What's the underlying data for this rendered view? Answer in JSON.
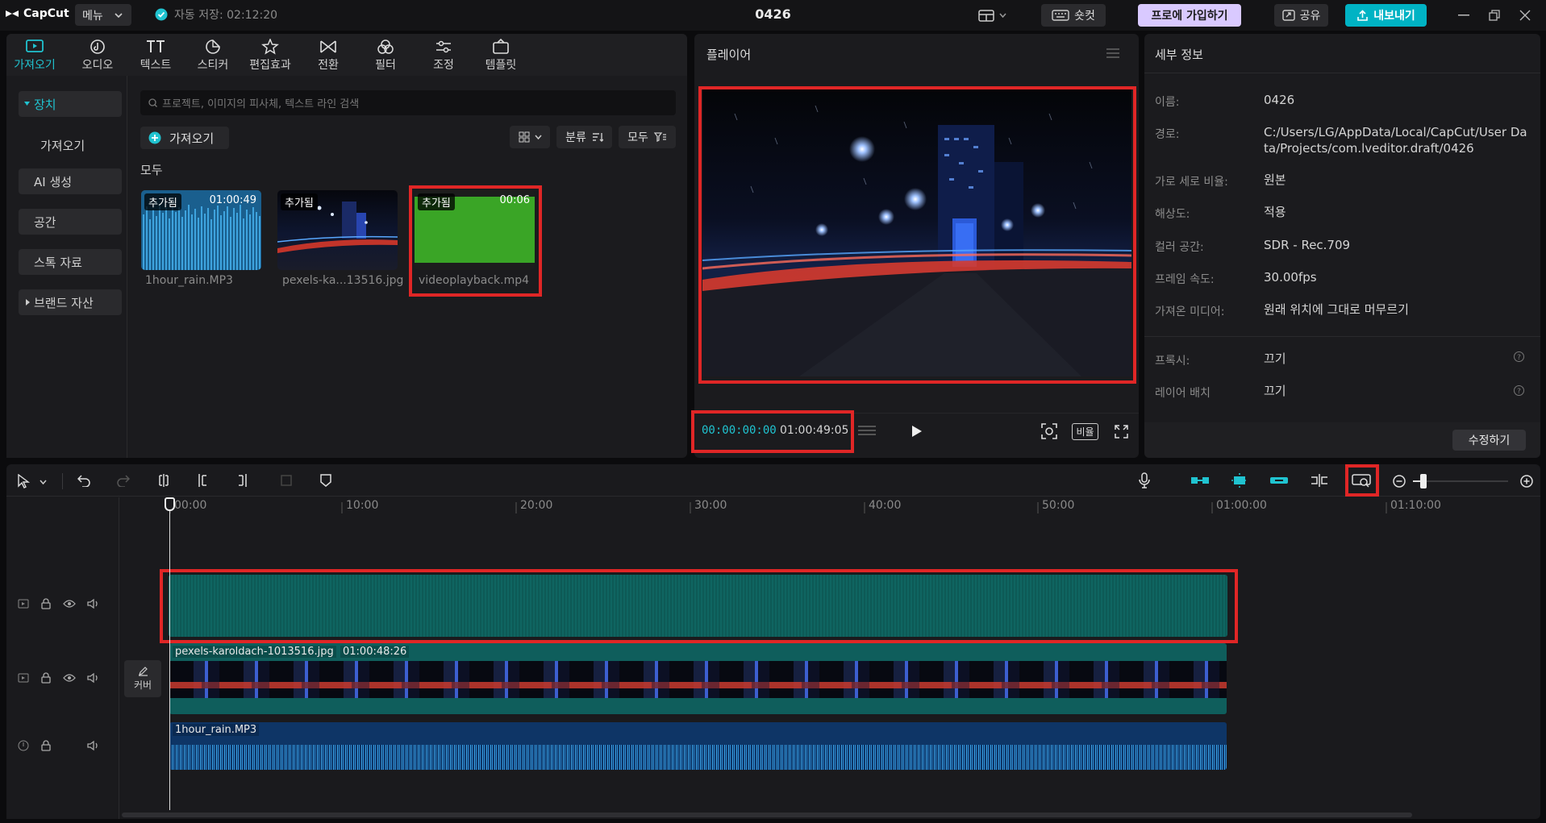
{
  "app": {
    "logo_text": "CapCut",
    "menu_label": "메뉴",
    "autosave": "자동 저장: 02:12:20",
    "project_title": "0426",
    "shortcut_label": "숏컷",
    "pro_label": "프로에 가입하기",
    "share_label": "공유",
    "export_label": "내보내기"
  },
  "colors": {
    "accent": "#20c3d0",
    "highlight": "#e02626",
    "export": "#00b3c4",
    "pro": "#d9c9ff"
  },
  "tabs": [
    {
      "label": "가져오기",
      "icon": "import-icon"
    },
    {
      "label": "오디오",
      "icon": "audio-icon"
    },
    {
      "label": "텍스트",
      "icon": "text-icon"
    },
    {
      "label": "스티커",
      "icon": "sticker-icon"
    },
    {
      "label": "편집효과",
      "icon": "effects-icon"
    },
    {
      "label": "전환",
      "icon": "transition-icon"
    },
    {
      "label": "필터",
      "icon": "filter-icon"
    },
    {
      "label": "조정",
      "icon": "adjust-icon"
    },
    {
      "label": "템플릿",
      "icon": "template-icon"
    }
  ],
  "sidebar": {
    "items": [
      {
        "label": "장치"
      },
      {
        "label": "가져오기"
      },
      {
        "label": "AI 생성"
      },
      {
        "label": "공간"
      },
      {
        "label": "스톡 자료"
      },
      {
        "label": "브랜드 자산"
      }
    ]
  },
  "media": {
    "search_placeholder": "프로젝트, 이미지의 피사체, 텍스트 라인 검색",
    "import_label": "가져오기",
    "sort_label": "분류",
    "filter_label": "모두",
    "section_label": "모두",
    "items": [
      {
        "badge": "추가됨",
        "duration": "01:00:49",
        "name": "1hour_rain.MP3"
      },
      {
        "badge": "추가됨",
        "duration": "",
        "name": "pexels-ka...13516.jpg"
      },
      {
        "badge": "추가됨",
        "duration": "00:06",
        "name": "videoplayback.mp4"
      }
    ]
  },
  "player": {
    "title": "플레이어",
    "current_time": "00:00:00:00",
    "total_time": "01:00:49:05",
    "ratio_label": "비율"
  },
  "details": {
    "title": "세부 정보",
    "rows": [
      {
        "label": "이름:",
        "value": "0426"
      },
      {
        "label": "경로:",
        "value": "C:/Users/LG/AppData/Local/CapCut/User Data/Projects/com.lveditor.draft/0426"
      },
      {
        "label": "가로 세로 비율:",
        "value": "원본"
      },
      {
        "label": "해상도:",
        "value": "적용"
      },
      {
        "label": "컬러 공간:",
        "value": "SDR - Rec.709"
      },
      {
        "label": "프레임 속도:",
        "value": "30.00fps"
      },
      {
        "label": "가져온 미디어:",
        "value": "원래 위치에 그대로 머무르기"
      }
    ],
    "proxy_label": "프록시:",
    "proxy_value": "끄기",
    "layer_label": "레이어 배치",
    "layer_value": "끄기",
    "edit_label": "수정하기"
  },
  "timeline": {
    "ruler": [
      "00:00",
      "10:00",
      "20:00",
      "30:00",
      "40:00",
      "50:00",
      "01:00:00",
      "01:10:00"
    ],
    "clip_image_name": "pexels-karoldach-1013516.jpg",
    "clip_image_duration": "01:00:48:26",
    "clip_audio_name": "1hour_rain.MP3",
    "cover_label": "커버"
  }
}
